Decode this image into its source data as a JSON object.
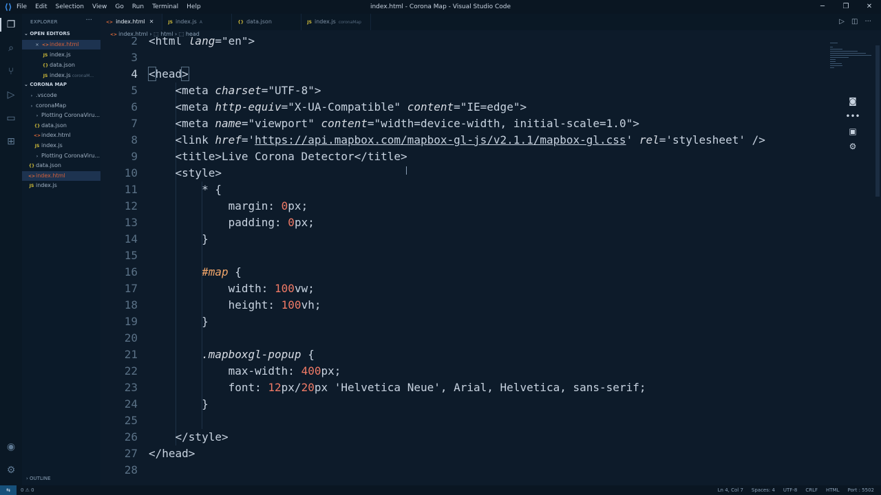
{
  "app": {
    "window_title": "index.html - Corona Map - Visual Studio Code",
    "menu": [
      "File",
      "Edit",
      "Selection",
      "View",
      "Go",
      "Run",
      "Terminal",
      "Help"
    ]
  },
  "sidebar": {
    "title": "EXPLORER",
    "open_editors_label": "OPEN EDITORS",
    "open_editors": [
      {
        "name": "index.html",
        "type": "html",
        "sub": "",
        "selected": true,
        "close": true
      },
      {
        "name": "index.js",
        "type": "js",
        "sub": ""
      },
      {
        "name": "data.json",
        "type": "json",
        "sub": ""
      },
      {
        "name": "index.js",
        "type": "js",
        "sub": "coronaM..."
      }
    ],
    "project_label": "CORONA MAP",
    "tree": [
      {
        "name": ".vscode",
        "type": "folder",
        "indent": 1
      },
      {
        "name": "coronaMap",
        "type": "folder",
        "indent": 1
      },
      {
        "name": "Plotting CoronaViru...",
        "type": "folder",
        "indent": 2
      },
      {
        "name": "data.json",
        "type": "json",
        "indent": 2
      },
      {
        "name": "index.html",
        "type": "html",
        "indent": 2
      },
      {
        "name": "index.js",
        "type": "js",
        "indent": 2
      },
      {
        "name": "Plotting CoronaViru...",
        "type": "folder",
        "indent": 2
      },
      {
        "name": "data.json",
        "type": "json",
        "indent": 1
      },
      {
        "name": "index.html",
        "type": "html",
        "indent": 1,
        "selected": true
      },
      {
        "name": "index.js",
        "type": "js",
        "indent": 1
      }
    ],
    "outline_label": "OUTLINE"
  },
  "tabs": [
    {
      "name": "index.html",
      "type": "html",
      "active": true,
      "sub": ""
    },
    {
      "name": "index.js",
      "type": "js",
      "sub": "A"
    },
    {
      "name": "data.json",
      "type": "json",
      "sub": ""
    },
    {
      "name": "index.js",
      "type": "js",
      "sub": "coronaMap"
    }
  ],
  "breadcrumb": [
    "index.html",
    "html",
    "head"
  ],
  "editor": {
    "current_line": 4,
    "lines": [
      {
        "n": 2,
        "text": "<html lang=\"en\">"
      },
      {
        "n": 3,
        "text": ""
      },
      {
        "n": 4,
        "text": "<head>"
      },
      {
        "n": 5,
        "text": "    <meta charset=\"UTF-8\">"
      },
      {
        "n": 6,
        "text": "    <meta http-equiv=\"X-UA-Compatible\" content=\"IE=edge\">"
      },
      {
        "n": 7,
        "text": "    <meta name=\"viewport\" content=\"width=device-width, initial-scale=1.0\">"
      },
      {
        "n": 8,
        "text": "    <link href='https://api.mapbox.com/mapbox-gl-js/v2.1.1/mapbox-gl.css' rel='stylesheet' />"
      },
      {
        "n": 9,
        "text": "    <title>Live Corona Detector</title>"
      },
      {
        "n": 10,
        "text": "    <style>"
      },
      {
        "n": 11,
        "text": "        * {"
      },
      {
        "n": 12,
        "text": "            margin: 0px;"
      },
      {
        "n": 13,
        "text": "            padding: 0px;"
      },
      {
        "n": 14,
        "text": "        }"
      },
      {
        "n": 15,
        "text": ""
      },
      {
        "n": 16,
        "text": "        #map {"
      },
      {
        "n": 17,
        "text": "            width: 100vw;"
      },
      {
        "n": 18,
        "text": "            height: 100vh;"
      },
      {
        "n": 19,
        "text": "        }"
      },
      {
        "n": 20,
        "text": ""
      },
      {
        "n": 21,
        "text": "        .mapboxgl-popup {"
      },
      {
        "n": 22,
        "text": "            max-width: 400px;"
      },
      {
        "n": 23,
        "text": "            font: 12px/20px 'Helvetica Neue', Arial, Helvetica, sans-serif;"
      },
      {
        "n": 24,
        "text": "        }"
      },
      {
        "n": 25,
        "text": ""
      },
      {
        "n": 26,
        "text": "    </style>"
      },
      {
        "n": 27,
        "text": "</head>"
      },
      {
        "n": 28,
        "text": ""
      }
    ]
  },
  "statusbar": {
    "problems": "0 ⚠ 0",
    "position": "Ln 4, Col 7",
    "spaces": "Spaces: 4",
    "encoding": "UTF-8",
    "eol": "CRLF",
    "language": "HTML",
    "port": "Port : 5502"
  },
  "colors": {
    "background": "#0d1b2a",
    "number": "#f07a66",
    "id_selector": "#f0a56a",
    "html_icon": "#e06b3a",
    "js_icon": "#d4bf3a"
  }
}
